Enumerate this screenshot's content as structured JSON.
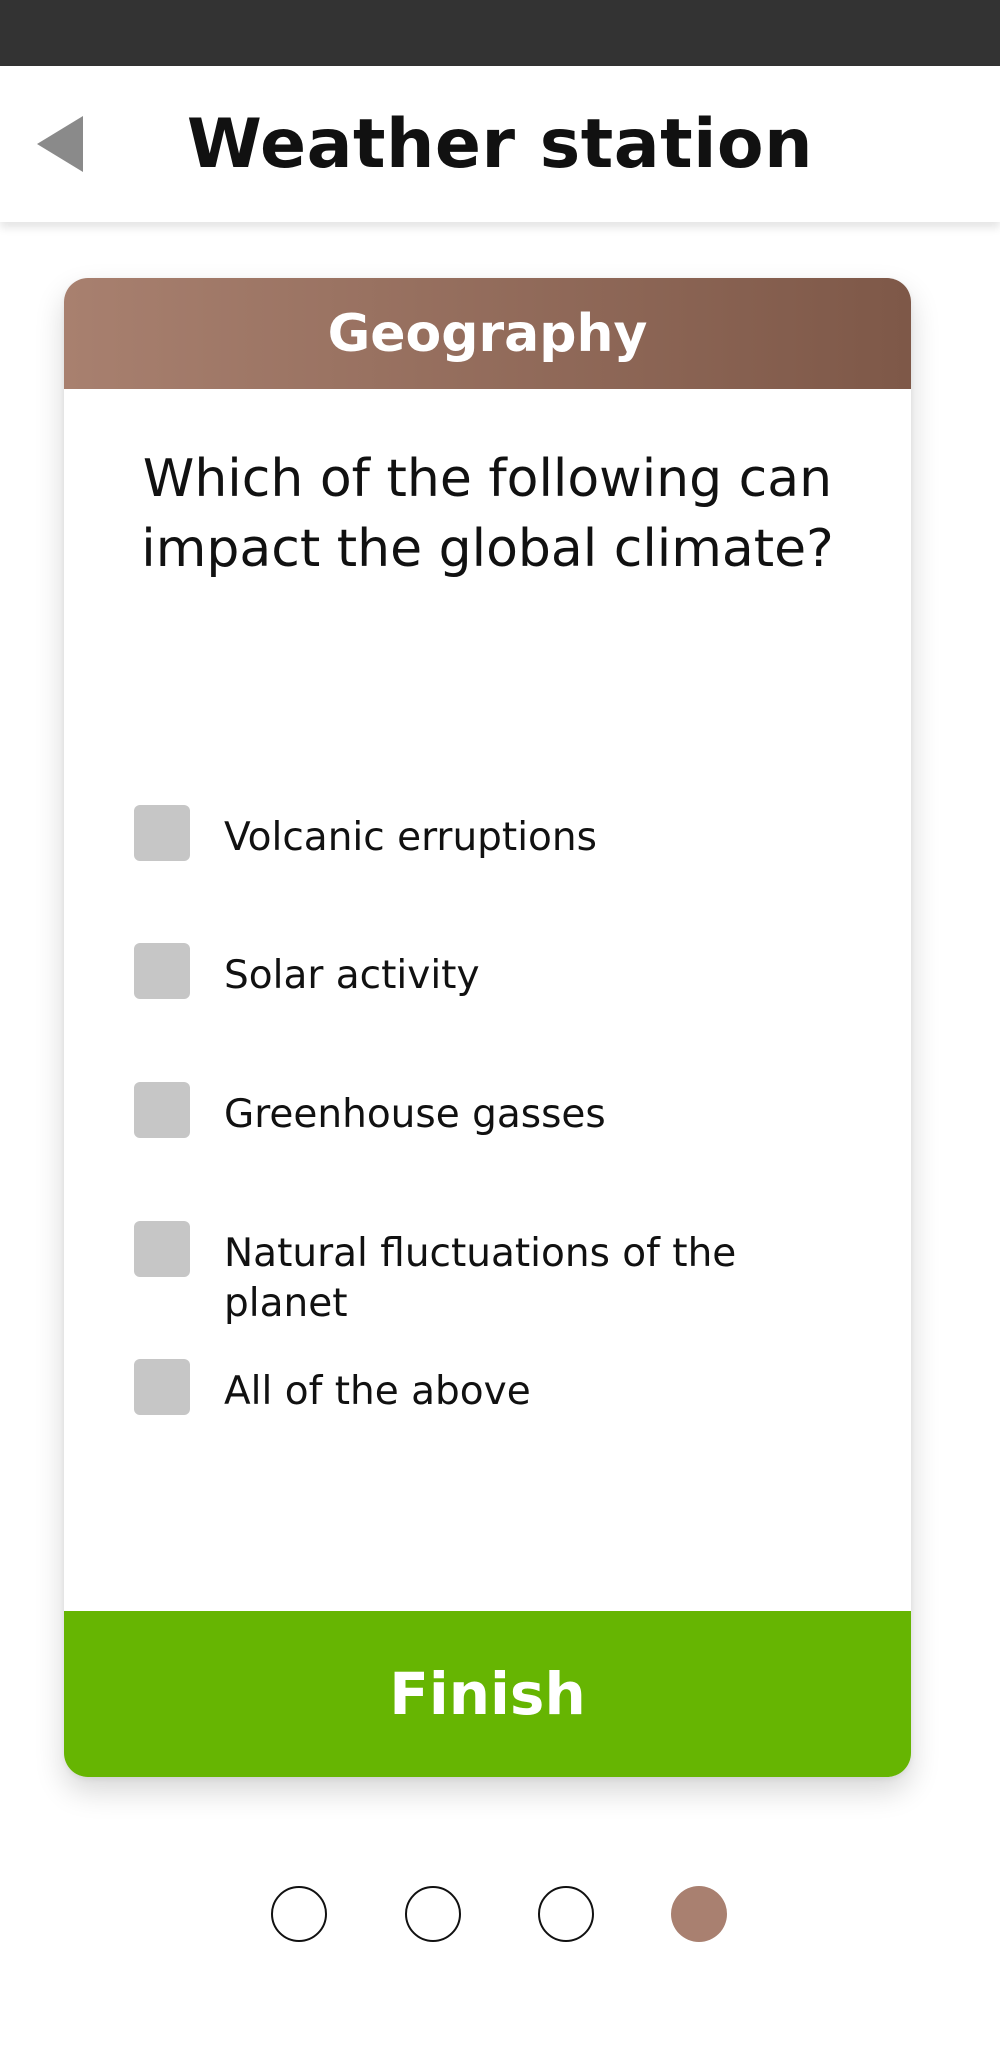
{
  "header": {
    "title": "Weather station",
    "back_icon": "back-triangle-icon"
  },
  "card": {
    "category": "Geography",
    "question": "Which of the following can impact the global climate?",
    "options": [
      {
        "label": "Volcanic erruptions",
        "checked": false
      },
      {
        "label": "Solar activity",
        "checked": false
      },
      {
        "label": "Greenhouse gasses",
        "checked": false
      },
      {
        "label": "Natural fluctuations of the planet",
        "checked": false
      },
      {
        "label": "All of the above",
        "checked": false
      }
    ],
    "finish_label": "Finish"
  },
  "pagination": {
    "total": 4,
    "current": 4
  },
  "colors": {
    "status_bar": "#333333",
    "card_header_start": "#a8806f",
    "card_header_end": "#7e5848",
    "finish_button": "#66b502",
    "active_dot": "#a98070",
    "checkbox": "#c6c6c6",
    "back_icon": "#8a8a8a"
  }
}
